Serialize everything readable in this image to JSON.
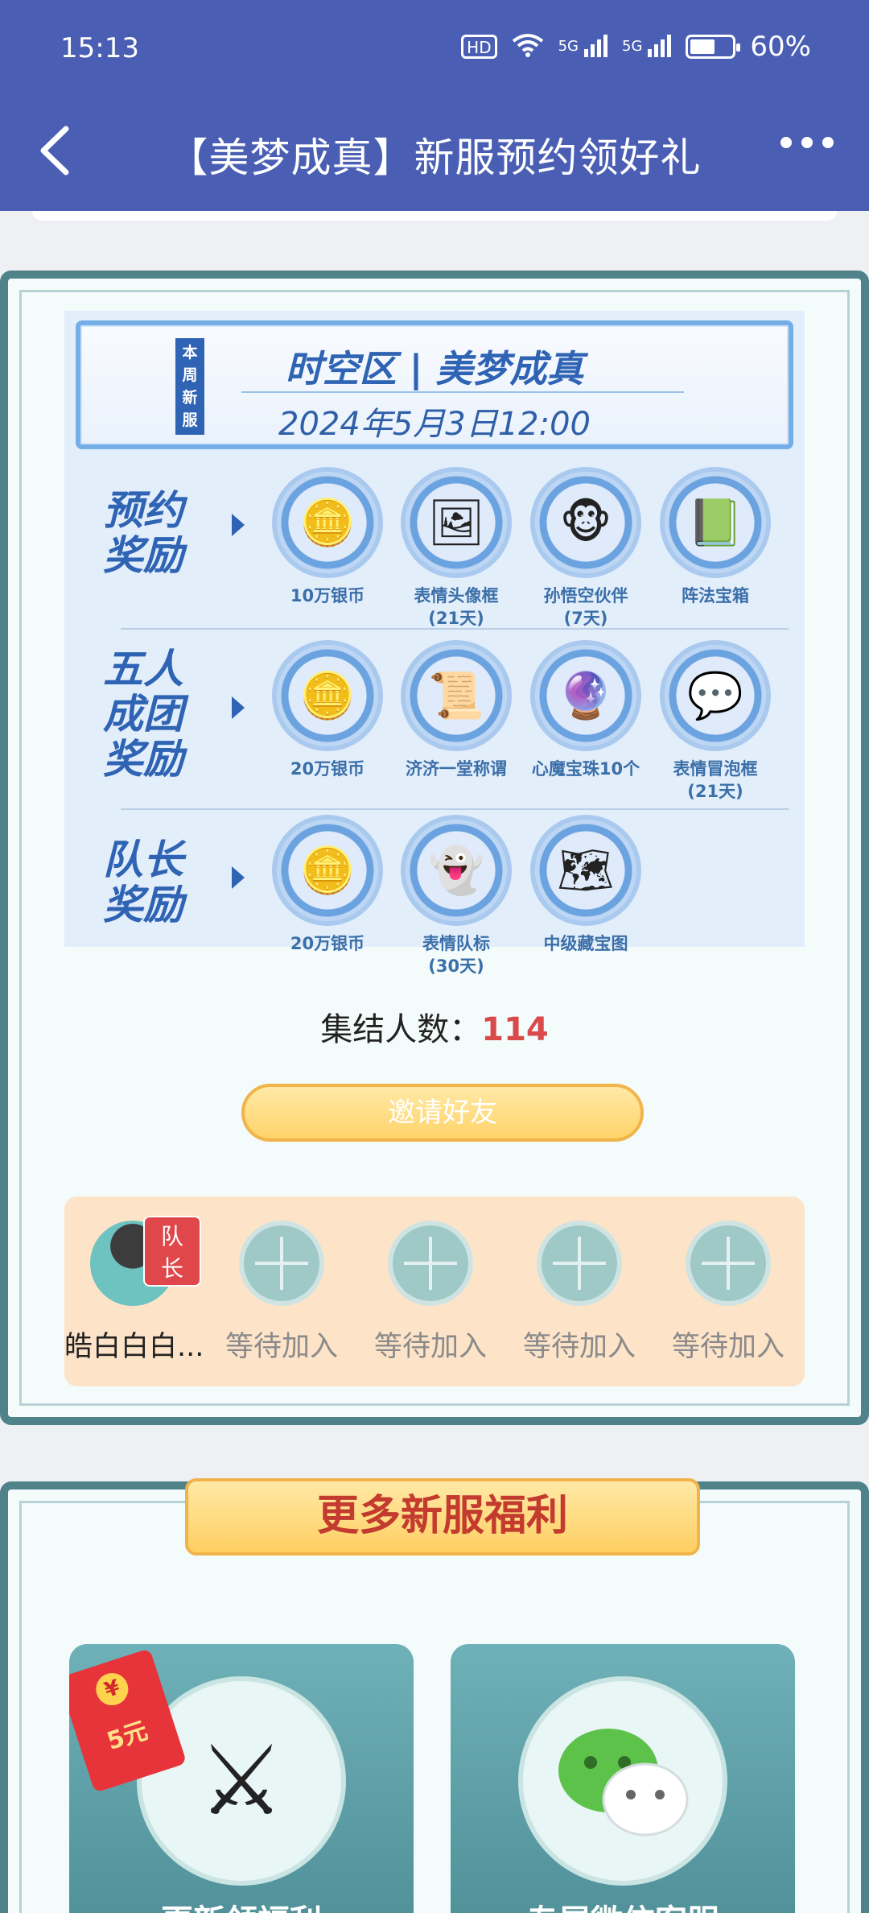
{
  "status_bar": {
    "time": "15:13",
    "hd_label": "HD",
    "net1": "5G",
    "net2": "5G",
    "battery": "60%",
    "battery_level": 0.6
  },
  "nav": {
    "title": "【美梦成真】新服预约领好礼"
  },
  "banner": {
    "week_badge": "本周新服",
    "server": "时空区 | 美梦成真",
    "date": "2024年5月3日12:00"
  },
  "rewards": [
    {
      "label": "预约奖励",
      "label_lines": [
        "预约",
        "奖励"
      ],
      "items": [
        {
          "icon": "silver-coin-icon",
          "glyph": "🪙",
          "lines": [
            "10万银币"
          ]
        },
        {
          "icon": "avatar-frame-icon",
          "glyph": "🖼",
          "lines": [
            "表情头像框",
            "(21天)"
          ]
        },
        {
          "icon": "sun-wukong-icon",
          "glyph": "🐵",
          "lines": [
            "孙悟空伙伴",
            "(7天)"
          ]
        },
        {
          "icon": "formation-chest-icon",
          "glyph": "📗",
          "lines": [
            "阵法宝箱"
          ]
        }
      ]
    },
    {
      "label": "五人成团奖励",
      "label_lines": [
        "五人",
        "成团",
        "奖励"
      ],
      "items": [
        {
          "icon": "silver-coin-icon",
          "glyph": "🪙",
          "lines": [
            "20万银币"
          ]
        },
        {
          "icon": "title-scroll-icon",
          "glyph": "📜",
          "lines": [
            "济济一堂称谓"
          ]
        },
        {
          "icon": "demon-orb-icon",
          "glyph": "🔮",
          "lines": [
            "心魔宝珠10个"
          ]
        },
        {
          "icon": "bubble-frame-icon",
          "glyph": "💬",
          "lines": [
            "表情冒泡框",
            "(21天)"
          ]
        }
      ]
    },
    {
      "label": "队长奖励",
      "label_lines": [
        "队长",
        "奖励"
      ],
      "items": [
        {
          "icon": "silver-coin-icon",
          "glyph": "🪙",
          "lines": [
            "20万银币"
          ]
        },
        {
          "icon": "team-mark-icon",
          "glyph": "👻",
          "lines": [
            "表情队标",
            "(30天)"
          ]
        },
        {
          "icon": "treasure-map-icon",
          "glyph": "🗺",
          "lines": [
            "中级藏宝图"
          ]
        }
      ]
    }
  ],
  "gather": {
    "label": "集结人数：",
    "count": "114"
  },
  "invite_button": "邀请好友",
  "team": {
    "captain_badge": "队长",
    "captain_name": "皓白白白...",
    "waiting_label": "等待加入",
    "slots": [
      "等待加入",
      "等待加入",
      "等待加入",
      "等待加入"
    ]
  },
  "more": {
    "title": "更多新服福利",
    "red_packet": "5元",
    "tile1_label": "更新领福利",
    "tile2_label": "专属微信客服"
  }
}
